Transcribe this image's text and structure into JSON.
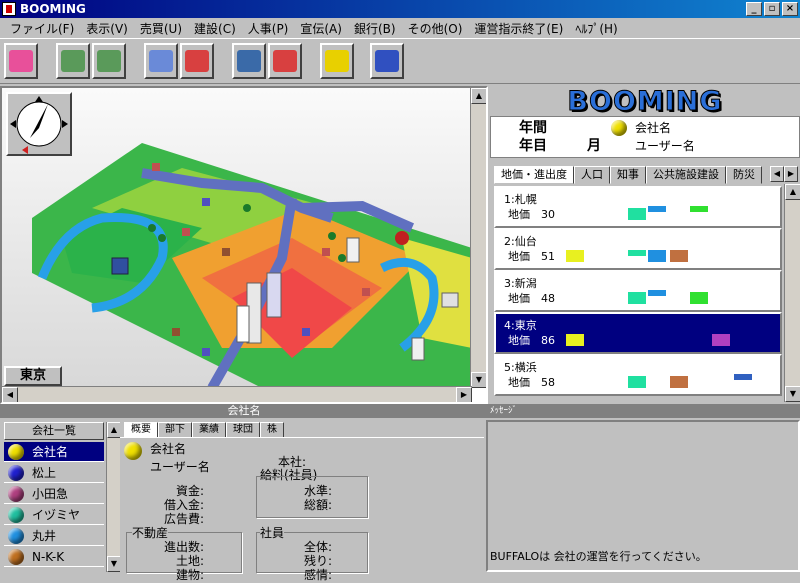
{
  "window": {
    "title": "BOOMING",
    "min": "_",
    "max": "▫",
    "close": "×"
  },
  "menu": [
    "ファイル(F)",
    "表示(V)",
    "売買(U)",
    "建設(C)",
    "人事(P)",
    "宣伝(A)",
    "銀行(B)",
    "その他(O)",
    "運営指示終了(E)",
    "ﾍﾙﾌﾟ(H)"
  ],
  "toolbar": [
    {
      "name": "land-icon",
      "color": "#e8509a"
    },
    {
      "name": "buy-sell-icon",
      "color": "#5a9a5a"
    },
    {
      "name": "trade-icon",
      "color": "#5a9a5a"
    },
    {
      "name": "building-icon",
      "color": "#6a8ad8"
    },
    {
      "name": "inspect-icon",
      "color": "#d84040"
    },
    {
      "name": "personnel-icon",
      "color": "#3a6aa8"
    },
    {
      "name": "staff-icon",
      "color": "#d84040"
    },
    {
      "name": "advisor-icon",
      "color": "#e8d000"
    },
    {
      "name": "go-icon",
      "color": "#3050c0"
    }
  ],
  "map": {
    "city_label": "東京"
  },
  "logo": "BOOMING",
  "info": {
    "year_label": "年間",
    "month_prefix": "年目",
    "month_suffix": "月",
    "company": "会社名",
    "user": "ユーザー名"
  },
  "city_tabs": [
    "地価・進出度",
    "人口",
    "知事",
    "公共施設建設",
    "防災"
  ],
  "cities": [
    {
      "name": "1:札幌",
      "value": "地価　30"
    },
    {
      "name": "2:仙台",
      "value": "地価　51"
    },
    {
      "name": "3:新潟",
      "value": "地価　48"
    },
    {
      "name": "4:東京",
      "value": "地価　86"
    },
    {
      "name": "5:横浜",
      "value": "地価　58"
    }
  ],
  "bottom": {
    "title": "会社名",
    "message_title": "ﾒｯｾｰｼﾞ",
    "company_list_header": "会社一覧",
    "companies": [
      {
        "name": "会社名",
        "color": "#f0e000"
      },
      {
        "name": "松上",
        "color": "#2020d0"
      },
      {
        "name": "小田急",
        "color": "#b04080"
      },
      {
        "name": "イヅミヤ",
        "color": "#20c0a0"
      },
      {
        "name": "丸井",
        "color": "#2090e0"
      },
      {
        "name": "N-K-K",
        "color": "#c07020"
      }
    ],
    "detail_tabs": [
      "概要",
      "部下",
      "業績",
      "球団",
      "株"
    ],
    "detail": {
      "company": "会社名",
      "user": "ユーザー名",
      "hq": "本社:",
      "salary_group": "給料(社員)",
      "capital": "資金:",
      "loan": "借入金:",
      "ad_cost": "広告費:",
      "level": "水準:",
      "total": "総額:",
      "realestate_group": "不動産",
      "progress": "進出数:",
      "land": "土地:",
      "building": "建物:",
      "staff_group": "社員",
      "all": "全体:",
      "remaining": "残り:",
      "morale": "感情:"
    },
    "message": "BUFFALOは 会社の運営を行ってください。"
  }
}
